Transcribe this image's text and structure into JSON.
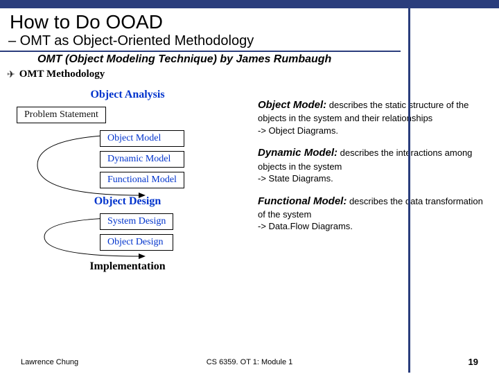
{
  "title": "How to Do OOAD",
  "subtitle": "– OMT as Object-Oriented Methodology",
  "subhead": "OMT (Object Modeling Technique) by James Rumbaugh",
  "omt_label": "OMT Methodology",
  "diagram": {
    "section_analysis": "Object Analysis",
    "section_design": "Object Design",
    "section_impl": "Implementation",
    "problem_statement": "Problem Statement",
    "object_model": "Object Model",
    "dynamic_model": "Dynamic Model",
    "functional_model": "Functional Model",
    "system_design": "System Design",
    "object_design": "Object Design"
  },
  "descriptions": {
    "object": {
      "title": "Object Model:",
      "body": " describes the static structure of the objects in the system and their relationships",
      "arrow": "-> Object Diagrams."
    },
    "dynamic": {
      "title": "Dynamic Model:",
      "body": " describes the interactions among objects in the system",
      "arrow": "-> State Diagrams."
    },
    "functional": {
      "title": "Functional Model:",
      "body": " describes the data transformation of the system",
      "arrow": "-> Data.Flow Diagrams."
    }
  },
  "footer": {
    "left": "Lawrence Chung",
    "center": "CS 6359. OT 1: Module 1",
    "right": "19"
  }
}
